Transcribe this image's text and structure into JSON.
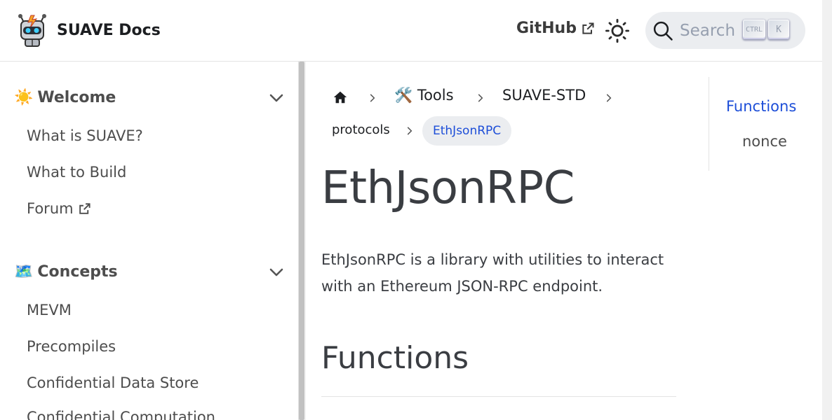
{
  "header": {
    "brand_title": "SUAVE Docs",
    "github_label": "GitHub",
    "search_label": "Search",
    "search_kbd_ctrl": "CTRL",
    "search_kbd_k": "K",
    "icons": {
      "logo": "robot-logo-icon",
      "external": "external-link-icon",
      "theme": "sun-icon",
      "search": "search-icon"
    }
  },
  "sidebar": {
    "categories": [
      {
        "emoji": "☀️",
        "label": "Welcome",
        "items": [
          "What is SUAVE?",
          "What to Build",
          "Forum"
        ]
      },
      {
        "emoji": "🗺️",
        "label": "Concepts",
        "items": [
          "MEVM",
          "Precompiles",
          "Confidential Data Store",
          "Confidential Computation"
        ]
      }
    ]
  },
  "breadcrumbs": {
    "home_icon": "home-icon",
    "items": [
      "🛠️ Tools",
      "SUAVE-STD",
      "protocols"
    ],
    "active": "EthJsonRPC"
  },
  "main": {
    "title": "EthJsonRPC",
    "intro": "EthJsonRPC is a library with utilities to interact with an Ethereum JSON-RPC endpoint.",
    "section_heading": "Functions"
  },
  "toc": {
    "items": [
      "Functions",
      "nonce"
    ]
  },
  "colors": {
    "accent": "#1d4ed8",
    "text": "#3a3d42",
    "pill_bg": "#ebedf0"
  }
}
